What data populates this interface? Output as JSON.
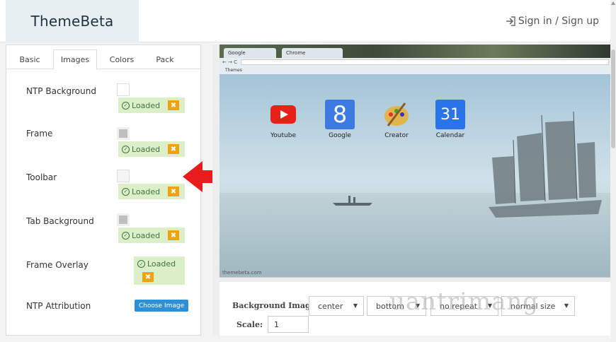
{
  "header": {
    "logo": "ThemeBeta",
    "signin": "Sign in / Sign up"
  },
  "tabs": [
    "Basic",
    "Images",
    "Colors",
    "Pack"
  ],
  "active_tab": "Images",
  "rows": [
    {
      "label": "NTP Background",
      "status": "Loaded"
    },
    {
      "label": "Frame",
      "status": "Loaded"
    },
    {
      "label": "Toolbar",
      "status": "Loaded"
    },
    {
      "label": "Tab Background",
      "status": "Loaded"
    },
    {
      "label": "Frame Overlay",
      "status": "Loaded"
    },
    {
      "label": "NTP Attribution",
      "button": "Choose Image"
    }
  ],
  "close_glyph": "✖",
  "preview": {
    "tab1": "Google",
    "tab2": "Chrome",
    "bookmark": "Themes",
    "apps": [
      {
        "label": "Youtube",
        "icon": "youtube-icon"
      },
      {
        "label": "Google",
        "icon": "google-icon"
      },
      {
        "label": "Creator",
        "icon": "creator-palette-icon"
      },
      {
        "label": "Calendar",
        "icon": "calendar-icon"
      }
    ],
    "calendar_day": "31",
    "google_glyph": "8",
    "attribution": "themebeta.com"
  },
  "controls": {
    "bg_label": "Background Image:",
    "position_x": "center",
    "position_y": "bottom",
    "repeat": "no repeat",
    "size": "normal size",
    "scale_label": "Scale:",
    "scale_value": "1",
    "watermark": "uantrimang"
  }
}
